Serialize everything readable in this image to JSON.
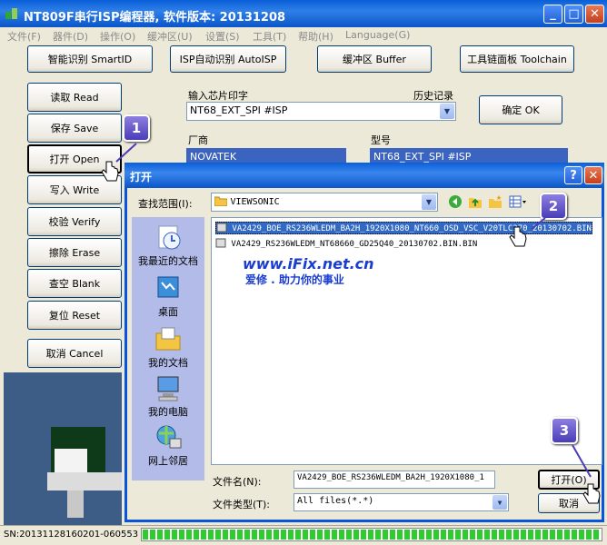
{
  "window": {
    "title": "NT809F串行ISP编程器, 软件版本: 20131208",
    "buttons": [
      "_",
      "□",
      "✕"
    ]
  },
  "menu": [
    "文件(F)",
    "器件(D)",
    "操作(O)",
    "缓冲区(U)",
    "设置(S)",
    "工具(T)",
    "帮助(H)",
    "Language(G)"
  ],
  "toolbar": {
    "smart_id": "智能识别 SmartID",
    "auto_isp": "ISP自动识别 AutoISP",
    "buffer": "缓冲区 Buffer",
    "toolchain": "工具链面板 Toolchain"
  },
  "side_buttons": {
    "read": "读取 Read",
    "save": "保存 Save",
    "open": "打开 Open",
    "write": "写入 Write",
    "verify": "校验 Verify",
    "erase": "擦除 Erase",
    "blank": "查空 Blank",
    "reset": "复位 Reset",
    "cancel": "取消 Cancel"
  },
  "chip_form": {
    "input_label": "输入芯片印字",
    "history_label": "历史记录",
    "chip_value": "NT68_EXT_SPI #ISP",
    "ok": "确定 OK",
    "vendor_label": "厂商",
    "vendor_value": "NOVATEK",
    "model_label": "型号",
    "model_value": "NT68_EXT_SPI #ISP"
  },
  "dialog": {
    "title": "打开",
    "help": "?",
    "close": "✕",
    "lookin_label": "查找范围(I):",
    "lookin_value": "VIEWSONIC",
    "places": [
      "我最近的文档",
      "桌面",
      "我的文档",
      "我的电脑",
      "网上邻居"
    ],
    "files": [
      "VA2429_BOE_RS236WLEDM_BA2H_1920X1080_NT660_OSD_VSC_V20TLC370_20130702.BIN",
      "VA2429_RS236WLEDM_NT68660_GD25Q40_20130702.BIN.BIN"
    ],
    "filename_label": "文件名(N):",
    "filename_value": "VA2429_BOE_RS236WLEDM_BA2H_1920X1080_1",
    "filetype_label": "文件类型(T):",
    "filetype_value": "All files(*.*)",
    "open_btn": "打开(O)",
    "cancel_btn": "取消"
  },
  "watermark": {
    "url": "www.iFix.net.cn",
    "slogan": "爱修 . 助力你的事业"
  },
  "badges": [
    "1",
    "2",
    "3"
  ],
  "status": {
    "sn": "SN:20131128160201-060553",
    "progress": 1.0
  },
  "colors": {
    "accent": "#0a5fd8",
    "selection": "#316ac5",
    "badge": "#5b4fcf",
    "progress": "#2ecc2e"
  }
}
